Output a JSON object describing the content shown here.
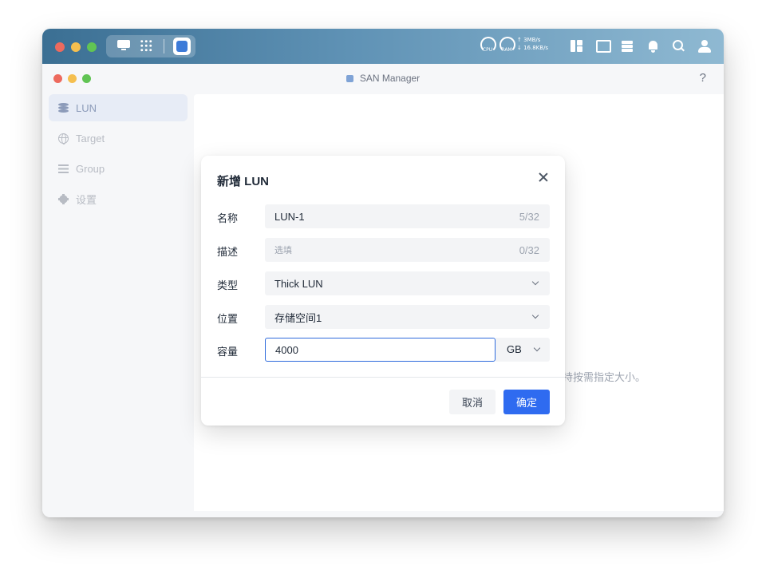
{
  "topbar": {
    "cpu_label": "CPU",
    "ram_label": "RAM",
    "net_up": "↑ 3MB/s",
    "net_down": "↓ 16.8KB/s"
  },
  "window": {
    "title": "SAN Manager",
    "help": "?"
  },
  "sidebar": {
    "items": [
      {
        "label": "LUN",
        "icon": "database-icon",
        "active": true
      },
      {
        "label": "Target",
        "icon": "globe-icon",
        "active": false
      },
      {
        "label": "Group",
        "icon": "list-icon",
        "active": false
      },
      {
        "label": "设置",
        "icon": "gear-icon",
        "active": false
      }
    ]
  },
  "content": {
    "background_text": "持按需指定大小。"
  },
  "dialog": {
    "title": "新增 LUN",
    "fields": {
      "name": {
        "label": "名称",
        "value": "LUN-1",
        "counter": "5/32"
      },
      "description": {
        "label": "描述",
        "placeholder": "选填",
        "counter": "0/32"
      },
      "type": {
        "label": "类型",
        "value": "Thick LUN"
      },
      "location": {
        "label": "位置",
        "value": "存储空间1"
      },
      "capacity": {
        "label": "容量",
        "value": "4000",
        "unit": "GB"
      }
    },
    "cancel_label": "取消",
    "ok_label": "确定"
  },
  "colors": {
    "accent": "#2f6bf0",
    "sidebar_active_bg": "#e7ecf6"
  }
}
